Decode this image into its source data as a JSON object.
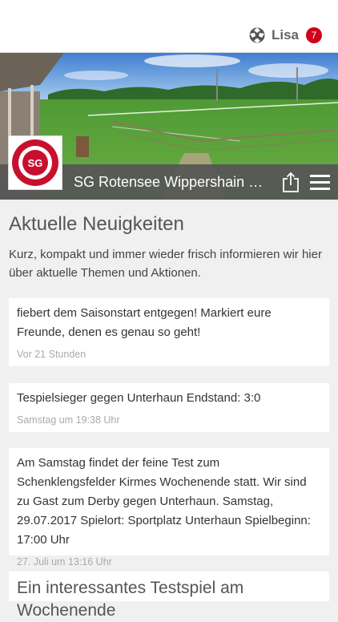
{
  "header": {
    "user_name": "Lisa",
    "notification_count": "7",
    "user_icon": "soccer-ball-icon"
  },
  "club": {
    "name": "SG Rotensee Wippershain Sc...",
    "logo_text": "SG"
  },
  "news": {
    "title": "Aktuelle Neuigkeiten",
    "intro": "Kurz, kompakt und immer wieder frisch informieren wir hier über aktuelle Themen und Aktionen.",
    "items": [
      {
        "text": "fiebert dem Saisonstart entgegen! Markiert eure Freunde, denen es genau so geht!",
        "time": "Vor 21 Stunden"
      },
      {
        "text": "Tespielsieger gegen Unterhaun Endstand: 3:0",
        "time": "Samstag um 19:38 Uhr"
      },
      {
        "text": "Am Samstag findet der feine Test zum Schenklengsfelder Kirmes Wochenende statt. Wir sind zu Gast zum Derby gegen Unterhaun. Samstag, 29.07.2017 Spielort: Sportplatz Unterhaun Spielbeginn: 17:00 Uhr",
        "time": "27. Juli um 13:16 Uhr"
      },
      {
        "text": "Ein interessantes Testspiel am Wochenende"
      }
    ]
  },
  "colors": {
    "badge": "#d0021b",
    "club_bar": "#555555",
    "background": "#f0f0f0"
  }
}
